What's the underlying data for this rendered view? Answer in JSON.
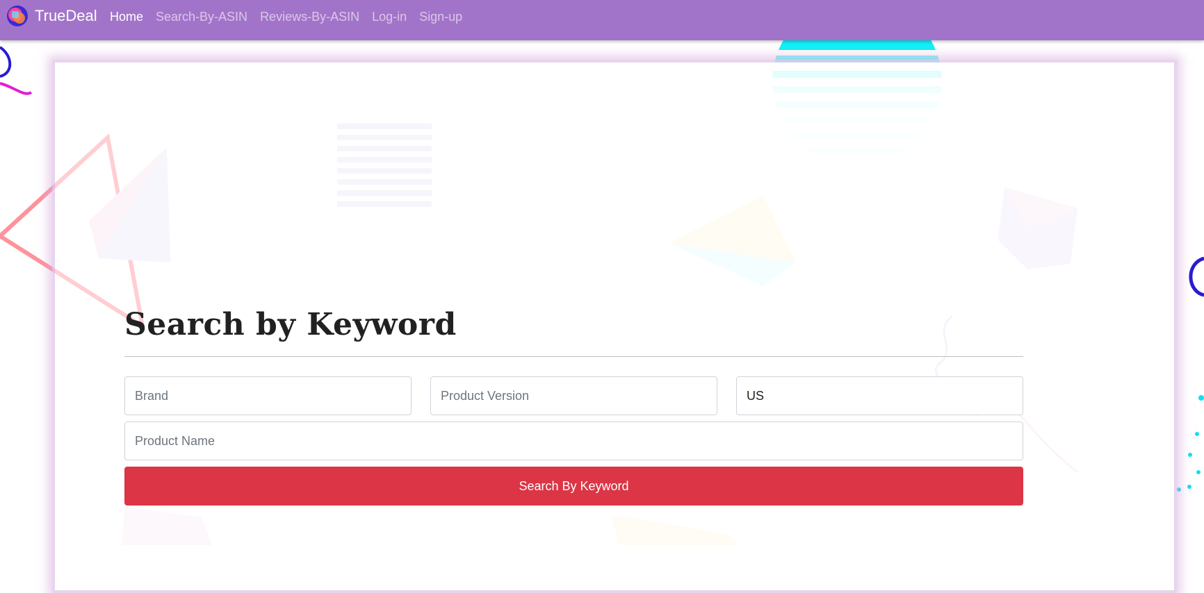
{
  "navbar": {
    "brand": "TrueDeal",
    "links": [
      {
        "label": "Home",
        "active": true
      },
      {
        "label": "Search-By-ASIN",
        "active": false
      },
      {
        "label": "Reviews-By-ASIN",
        "active": false
      },
      {
        "label": "Log-in",
        "active": false
      },
      {
        "label": "Sign-up",
        "active": false
      }
    ],
    "background_color": "#a274c9"
  },
  "form": {
    "title": "Search by Keyword",
    "brand_placeholder": "Brand",
    "version_placeholder": "Product Version",
    "country_value": "US",
    "name_placeholder": "Product Name",
    "button_label": "Search By Keyword",
    "button_color": "#dc3545"
  }
}
